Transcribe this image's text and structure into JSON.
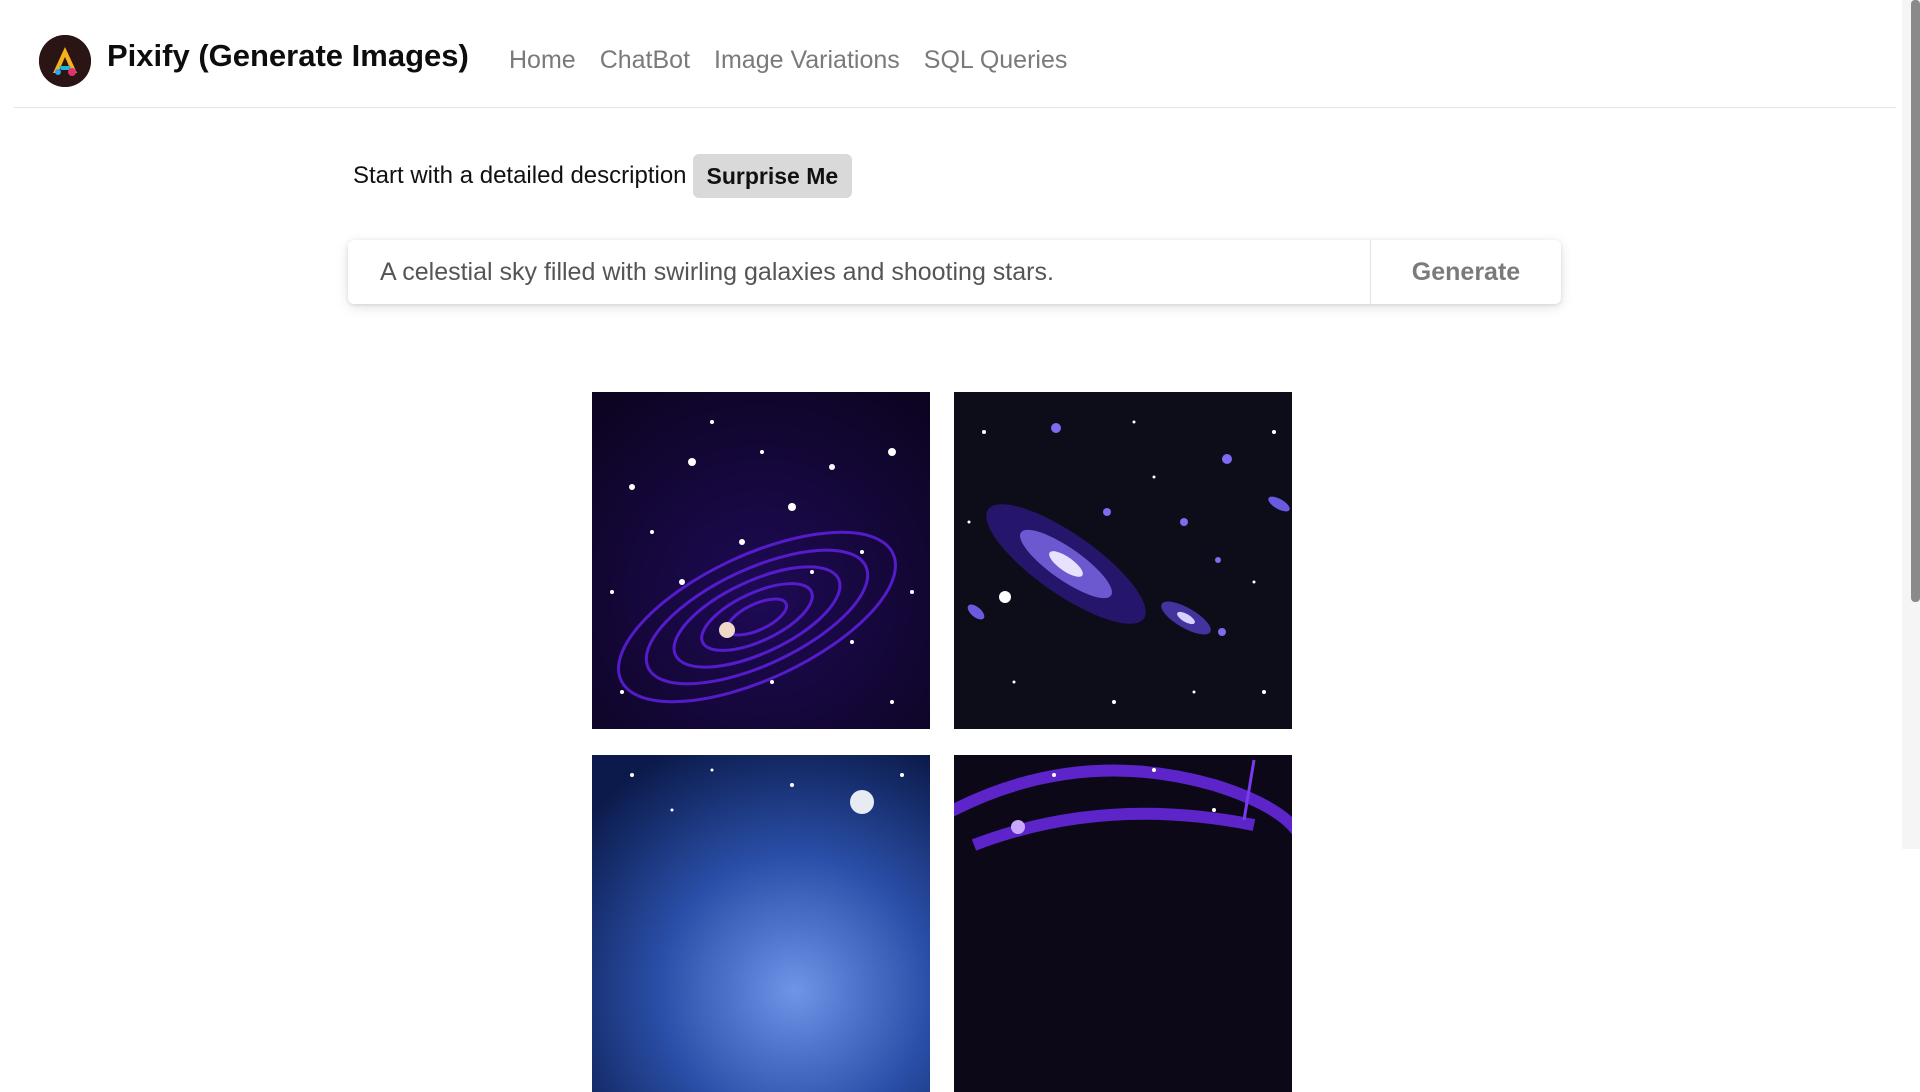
{
  "header": {
    "app_title": "Pixify (Generate Images)",
    "logo_icon": "pixify-logo",
    "nav": [
      {
        "label": "Home"
      },
      {
        "label": "ChatBot"
      },
      {
        "label": "Image Variations"
      },
      {
        "label": "SQL Queries"
      }
    ]
  },
  "prompt": {
    "hint": "Start with a detailed description",
    "surprise_label": "Surprise Me",
    "value": "A celestial sky filled with swirling galaxies and shooting stars.",
    "generate_label": "Generate"
  },
  "gallery": {
    "images": [
      {
        "subject": "spiral-galaxy-rings"
      },
      {
        "subject": "galaxy-field"
      },
      {
        "subject": "blue-nebula"
      },
      {
        "subject": "purple-rings"
      }
    ]
  },
  "colors": {
    "nav_text": "#7a7a7a",
    "button_bg": "#d9d9d9",
    "space_purple": "#2a0a6b",
    "space_dark": "#0d0d1a"
  }
}
